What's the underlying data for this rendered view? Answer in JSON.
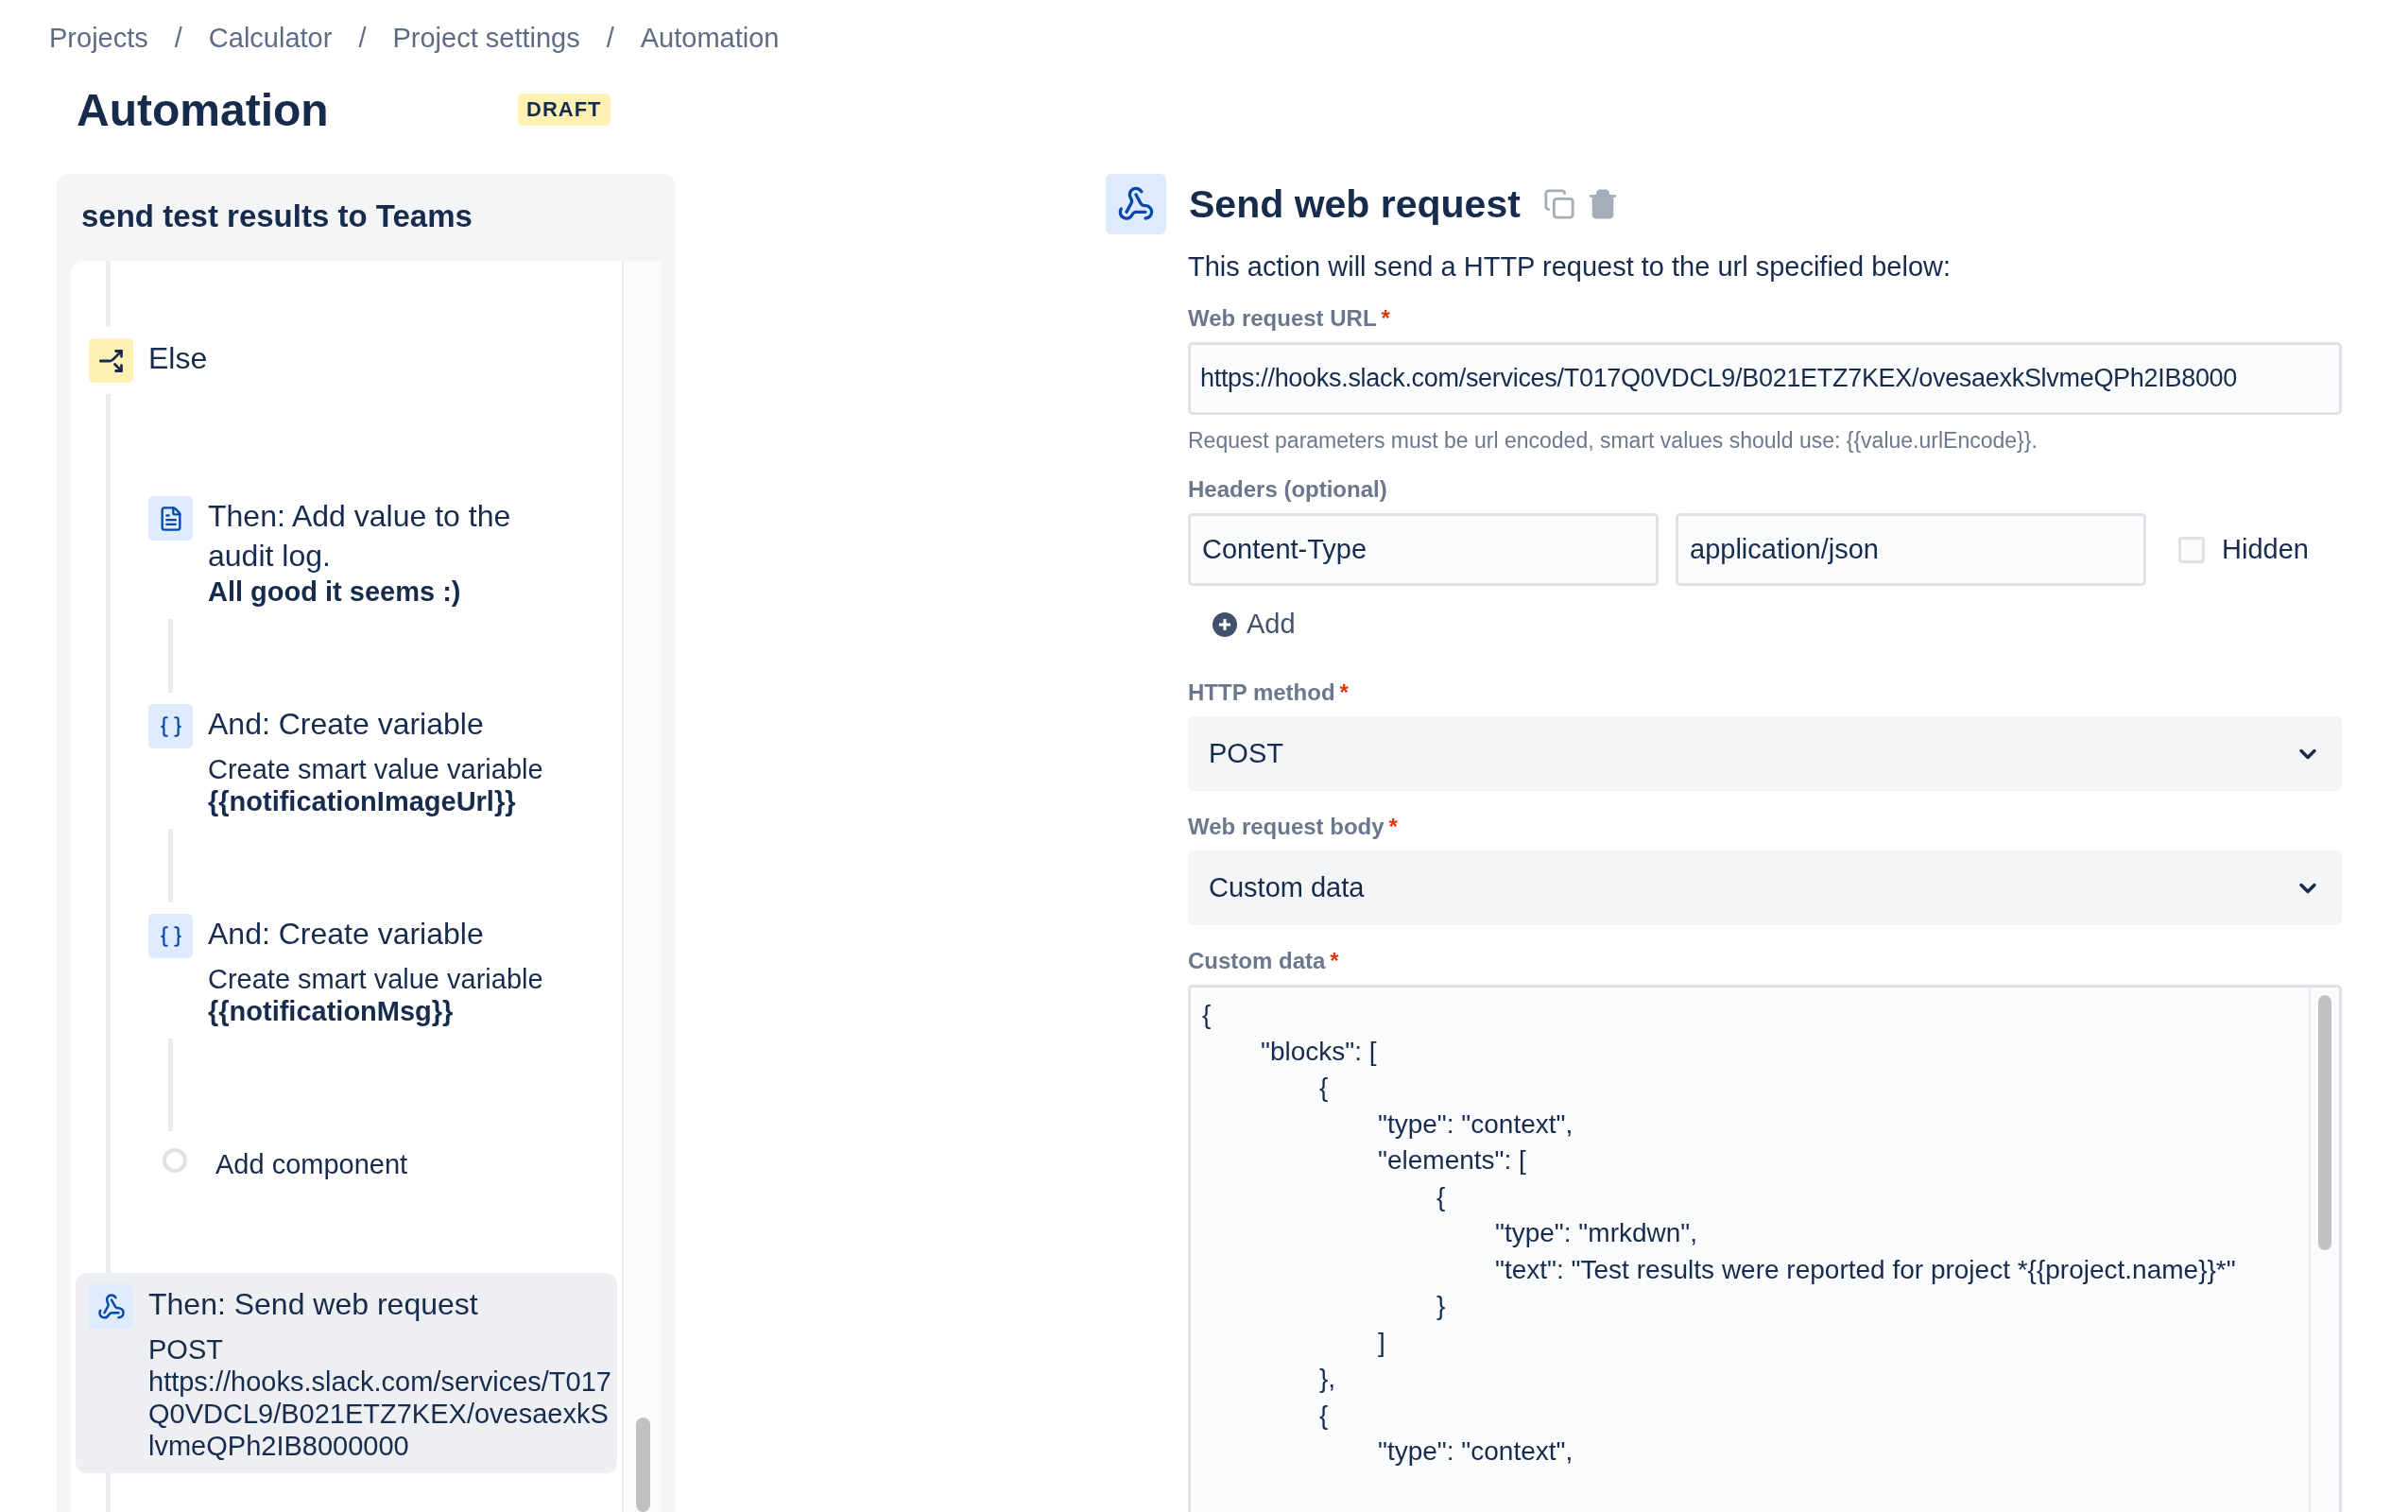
{
  "breadcrumbs": [
    "Projects",
    "Calculator",
    "Project settings",
    "Automation"
  ],
  "breadcrumb_separator": "/",
  "page": {
    "title": "Automation",
    "badge": "DRAFT"
  },
  "rule": {
    "title": "send test results to Teams",
    "components": [
      {
        "kind": "branch",
        "title": "Else",
        "selected": false,
        "children": [
          {
            "kind": "audit",
            "title": "Then: Add value to the audit log.",
            "selected": false,
            "details": [
              {
                "text": "All good it seems :)",
                "bold": true
              }
            ]
          },
          {
            "kind": "variable",
            "title": "And: Create variable",
            "selected": false,
            "details": [
              {
                "text": "Create smart value variable",
                "bold": false
              },
              {
                "text": "{{notificationImageUrl}}",
                "bold": true
              }
            ]
          },
          {
            "kind": "variable",
            "title": "And: Create variable",
            "selected": false,
            "details": [
              {
                "text": "Create smart value variable",
                "bold": false
              },
              {
                "text": "{{notificationMsg}}",
                "bold": true
              }
            ]
          },
          {
            "kind": "add",
            "title": "Add component",
            "selected": false
          }
        ]
      },
      {
        "kind": "webhook",
        "title": "Then: Send web request",
        "selected": true,
        "details": [
          {
            "text": "POST",
            "bold": false
          },
          {
            "text": "https://hooks.slack.com/services/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00",
            "bold": false
          }
        ]
      }
    ]
  },
  "editor": {
    "title": "Send web request",
    "description": "This action will send a HTTP request to the url specified below:",
    "url": {
      "label": "Web request URL",
      "required_mark": "*",
      "value": "https://hooks.slack.com/services/T017Q0VDCL9/B021ETZ7KEX/ovesaexkSlvmeQPh2IB8000",
      "help": "Request parameters must be url encoded, smart values should use: {{value.urlEncode}}."
    },
    "headers": {
      "label": "Headers (optional)",
      "rows": [
        {
          "name": "Content-Type",
          "value": "application/json",
          "hidden": false,
          "hidden_label": "Hidden"
        }
      ],
      "add": "Add"
    },
    "method": {
      "label": "HTTP method",
      "required_mark": "*",
      "value": "POST"
    },
    "body": {
      "label": "Web request body",
      "required_mark": "*",
      "value": "Custom data"
    },
    "custom_data": {
      "label": "Custom data",
      "required_mark": "*",
      "lines": [
        "{",
        "\t\"blocks\": [",
        "\t\t{",
        "\t\t\t\"type\": \"context\",",
        "\t\t\t\"elements\": [",
        "\t\t\t\t{",
        "\t\t\t\t\t\"type\": \"mrkdwn\",",
        "\t\t\t\t\t\"text\": \"Test results were reported for project *{{project.name}}*\"",
        "\t\t\t\t}",
        "\t\t\t]",
        "\t\t},",
        "\t\t{",
        "\t\t\t\"type\": \"context\","
      ]
    }
  }
}
